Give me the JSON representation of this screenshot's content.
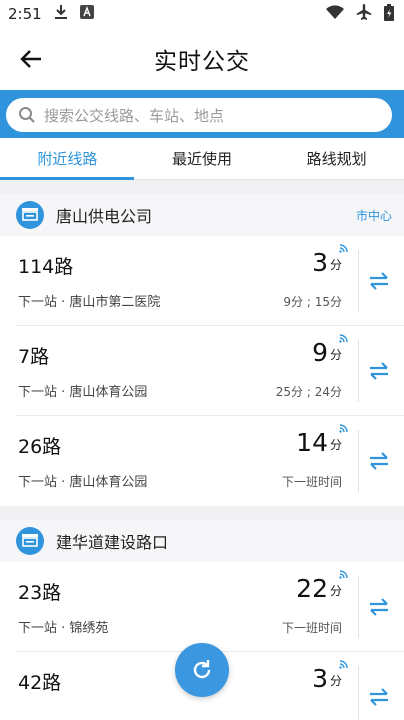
{
  "status_bar": {
    "time": "2:51"
  },
  "header": {
    "title": "实时公交"
  },
  "search": {
    "placeholder": "搜索公交线路、车站、地点"
  },
  "tabs": [
    {
      "label": "附近线路",
      "active": true
    },
    {
      "label": "最近使用",
      "active": false
    },
    {
      "label": "路线规划",
      "active": false
    }
  ],
  "stops": [
    {
      "name": "唐山供电公司",
      "tag": "市中心",
      "routes": [
        {
          "name": "114路",
          "next": "下一站 · 唐山市第二医院",
          "eta": "3",
          "unit": "分",
          "sub": "9分 ; 15分"
        },
        {
          "name": "7路",
          "next": "下一站 · 唐山体育公园",
          "eta": "9",
          "unit": "分",
          "sub": "25分 ; 24分"
        },
        {
          "name": "26路",
          "next": "下一站 · 唐山体育公园",
          "eta": "14",
          "unit": "分",
          "sub": "下一班时间"
        }
      ]
    },
    {
      "name": "建华道建设路口",
      "routes": [
        {
          "name": "23路",
          "next": "下一站 · 锦绣苑",
          "eta": "22",
          "unit": "分",
          "sub": "下一班时间"
        },
        {
          "name": "42路",
          "eta": "3",
          "unit": "分"
        }
      ]
    }
  ],
  "colors": {
    "accent": "#2f94dc"
  }
}
